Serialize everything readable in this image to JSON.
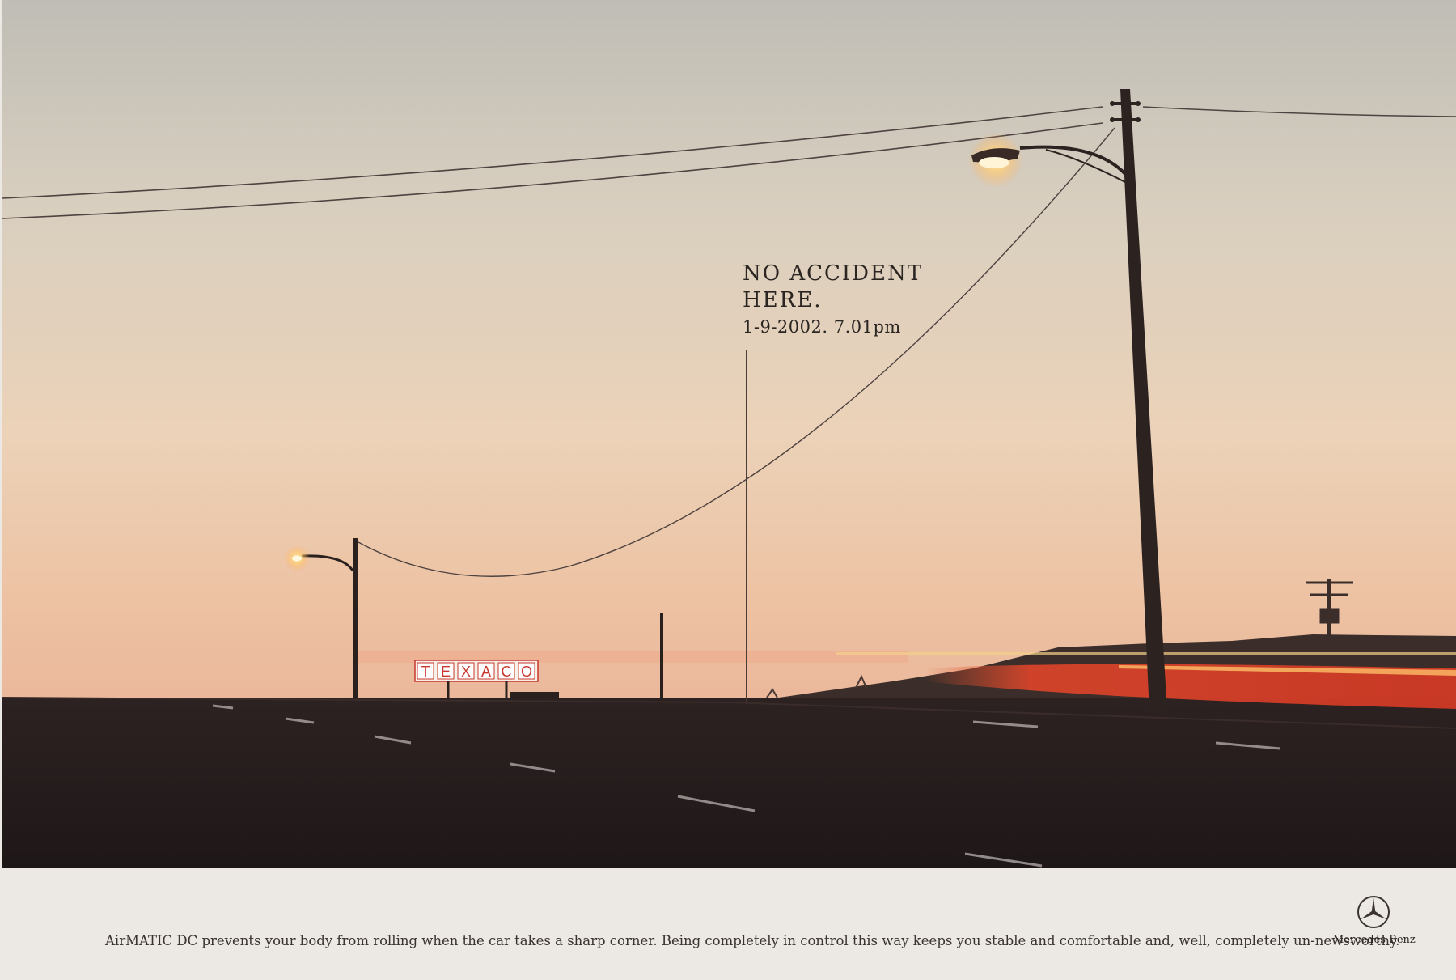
{
  "headline": {
    "line1": "NO ACCIDENT",
    "line2": "HERE.",
    "dateline": "1-9-2002. 7.01pm"
  },
  "sign": {
    "letters": [
      "T",
      "E",
      "X",
      "A",
      "C",
      "O"
    ]
  },
  "footer": {
    "copy": "AirMATIC DC prevents your body from rolling when the car takes a sharp corner. Being completely in control this way keeps you stable and comfortable and, well, completely un-newsworthy.",
    "brand": "Mercedes-Benz",
    "logo_icon": "three-pointed-star-icon"
  },
  "colors": {
    "sky_top": "#bfbdb6",
    "sky_horizon": "#ecbfa0",
    "road": "#221a1a",
    "light_trail": "#e04020",
    "footer_bg": "#ece8e4"
  }
}
